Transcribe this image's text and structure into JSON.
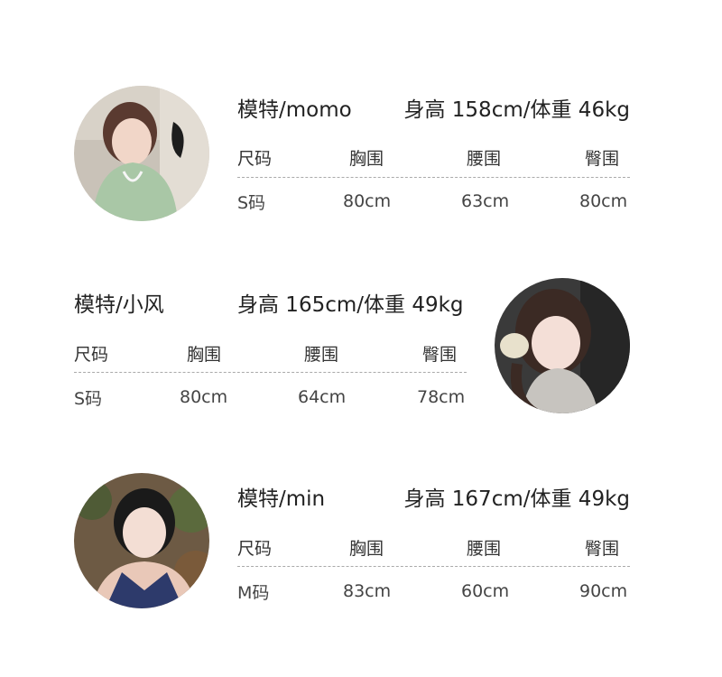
{
  "headers": {
    "size": "尺码",
    "bust": "胸围",
    "waist": "腰围",
    "hip": "臀围"
  },
  "models": [
    {
      "name": "模特/momo",
      "stats": "身高 158cm/体重 46kg",
      "size": "S码",
      "bust": "80cm",
      "waist": "63cm",
      "hip": "80cm"
    },
    {
      "name": "模特/小风",
      "stats": "身高 165cm/体重 49kg",
      "size": "S码",
      "bust": "80cm",
      "waist": "64cm",
      "hip": "78cm"
    },
    {
      "name": "模特/min",
      "stats": "身高 167cm/体重 49kg",
      "size": "M码",
      "bust": "83cm",
      "waist": "60cm",
      "hip": "90cm"
    }
  ]
}
